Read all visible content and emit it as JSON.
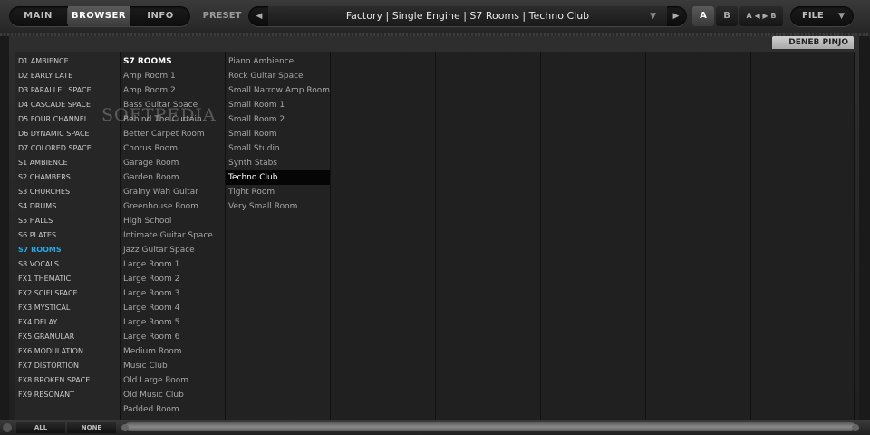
{
  "toolbar": {
    "tabs": [
      "MAIN",
      "BROWSER",
      "INFO"
    ],
    "preset_label": "PRESET",
    "preset_name": "Factory | Single Engine | S7 Rooms | Techno Club",
    "prev": "◀",
    "next": "▶",
    "dropdown": "▼",
    "btn_a": "A",
    "btn_b": "B",
    "ab_swap": "A ◀ ▶ B",
    "file": "FILE",
    "file_arrow": "▼"
  },
  "user": "DENEB PINJO",
  "categories": [
    "D1 AMBIENCE",
    "D2 EARLY LATE",
    "D3 PARALLEL SPACE",
    "D4 CASCADE SPACE",
    "D5 FOUR CHANNEL",
    "D6 DYNAMIC SPACE",
    "D7 COLORED SPACE",
    "S1 AMBIENCE",
    "S2 CHAMBERS",
    "S3 CHURCHES",
    "S4 DRUMS",
    "S5 HALLS",
    "S6 PLATES",
    "S7 ROOMS",
    "S8 VOCALS",
    "FX1 THEMATIC",
    "FX2 SCIFI SPACE",
    "FX3 MYSTICAL",
    "FX4 DELAY",
    "FX5 GRANULAR",
    "FX6 MODULATION",
    "FX7 DISTORTION",
    "FX8 BROKEN SPACE",
    "FX9 RESONANT"
  ],
  "selected_category": "S7 ROOMS",
  "col1": [
    "S7 ROOMS",
    "Amp Room 1",
    "Amp Room 2",
    "Bass Guitar Space",
    "Behind The Curtain",
    "Better Carpet Room",
    "Chorus Room",
    "Garage Room",
    "Garden Room",
    "Grainy Wah Guitar",
    "Greenhouse Room",
    "High School",
    "Intimate Guitar Space",
    "Jazz Guitar Space",
    "Large Room 1",
    "Large Room 2",
    "Large Room 3",
    "Large Room 4",
    "Large Room 5",
    "Large Room 6",
    "Medium Room",
    "Music Club",
    "Old Large Room",
    "Old Music Club",
    "Padded Room"
  ],
  "col2": [
    "Piano Ambience",
    "Rock Guitar Space",
    "Small Narrow Amp Room",
    "Small Room 1",
    "Small Room 2",
    "Small Room",
    "Small Studio",
    "Synth Stabs",
    "Techno Club",
    "Tight Room",
    "Very Small Room"
  ],
  "selected_preset": "Techno Club",
  "bottom": {
    "all": "ALL",
    "none": "NONE"
  },
  "watermark": "SOFTPEDIA",
  "colors": {
    "accent": "#27a9e8",
    "background": "#1a1a1a",
    "selection": "#050505"
  }
}
